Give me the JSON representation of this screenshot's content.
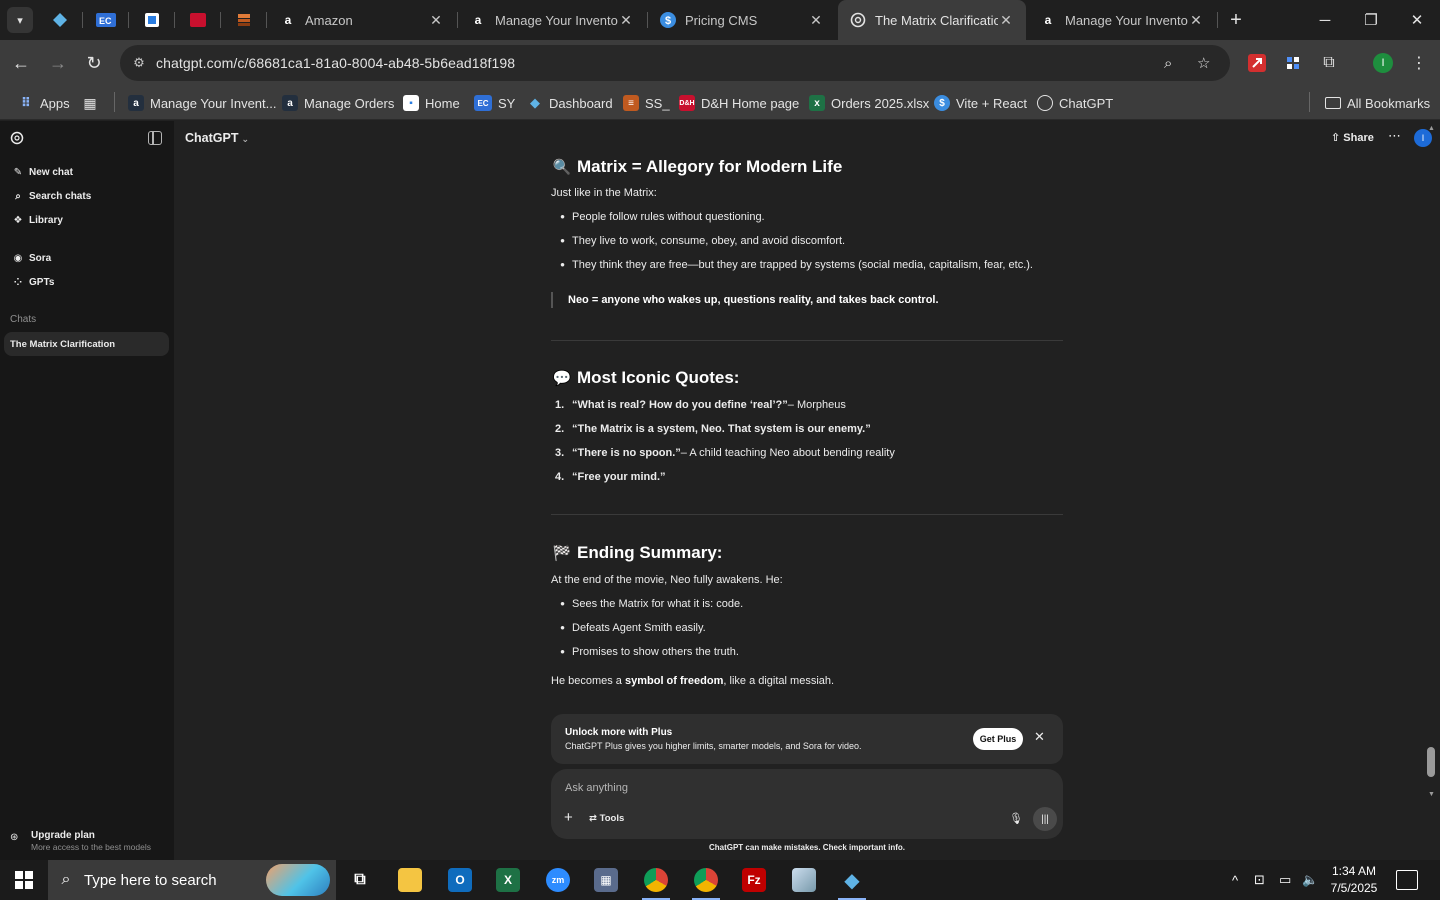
{
  "browser": {
    "tabs": [
      {
        "title": "Amazon",
        "favicon": "amazon-icon"
      },
      {
        "title": "Manage Your Inventory",
        "favicon": "amazon-icon"
      },
      {
        "title": "Pricing CMS",
        "favicon": "dollar-icon"
      },
      {
        "title": "The Matrix Clarification",
        "favicon": "openai-icon",
        "active": true
      },
      {
        "title": "Manage Your Inventory",
        "favicon": "amazon-icon"
      }
    ],
    "url": "chatgpt.com/c/68681ca1-81a0-8004-ab48-5b6ead18f198",
    "bookmarks": [
      {
        "label": "Apps"
      },
      {
        "label": "Manage Your Invent..."
      },
      {
        "label": "Manage Orders"
      },
      {
        "label": "Home"
      },
      {
        "label": "SY"
      },
      {
        "label": "Dashboard"
      },
      {
        "label": "SS_"
      },
      {
        "label": "D&H Home page"
      },
      {
        "label": "Orders 2025.xlsx"
      },
      {
        "label": "Vite + React"
      },
      {
        "label": "ChatGPT"
      }
    ],
    "all_bookmarks": "All Bookmarks",
    "profile_initial": "I"
  },
  "sidebar": {
    "items": [
      {
        "label": "New chat",
        "icon": "edit-icon"
      },
      {
        "label": "Search chats",
        "icon": "search-icon"
      },
      {
        "label": "Library",
        "icon": "library-icon"
      },
      {
        "label": "Sora",
        "icon": "sora-icon"
      },
      {
        "label": "GPTs",
        "icon": "grid-icon"
      }
    ],
    "chats_heading": "Chats",
    "active_chat": "The Matrix Clarification",
    "upgrade_title": "Upgrade plan",
    "upgrade_subtitle": "More access to the best models"
  },
  "header": {
    "model": "ChatGPT",
    "share": "Share",
    "avatar_initial": "I"
  },
  "message": {
    "section1": {
      "heading": "Matrix = Allegory for Modern Life",
      "intro": "Just like in the Matrix:",
      "bullets": [
        "People follow rules without questioning.",
        "They live to work, consume, obey, and avoid discomfort.",
        "They think they are free—but they are trapped by systems (social media, capitalism, fear, etc.)."
      ],
      "quote": "Neo = anyone who wakes up, questions reality, and takes back control."
    },
    "section2": {
      "heading": "Most Iconic Quotes:",
      "quotes": [
        {
          "num": "1.",
          "text": "“What is real? How do you define ‘real’?”",
          "suffix": " – Morpheus"
        },
        {
          "num": "2.",
          "text": "“The Matrix is a system, Neo. That system is our enemy.”",
          "suffix": ""
        },
        {
          "num": "3.",
          "text": "“There is no spoon.”",
          "suffix": " – A child teaching Neo about bending reality"
        },
        {
          "num": "4.",
          "text": "“Free your mind.”",
          "suffix": ""
        }
      ]
    },
    "section3": {
      "heading": "Ending Summary:",
      "intro": "At the end of the movie, Neo fully awakens. He:",
      "bullets": [
        "Sees the Matrix for what it is: code.",
        "Defeats Agent Smith easily.",
        "Promises to show others the truth."
      ],
      "closing_pre": "He becomes a ",
      "closing_bold": "symbol of freedom",
      "closing_post": ", like a digital messiah."
    }
  },
  "upsell": {
    "title": "Unlock more with Plus",
    "body": "ChatGPT Plus gives you higher limits, smarter models, and Sora for video.",
    "button": "Get Plus"
  },
  "composer": {
    "placeholder": "Ask anything",
    "tools": "Tools"
  },
  "disclaimer": "ChatGPT can make mistakes. Check important info.",
  "taskbar": {
    "search_placeholder": "Type here to search",
    "time": "1:34 AM",
    "date": "7/5/2025"
  }
}
